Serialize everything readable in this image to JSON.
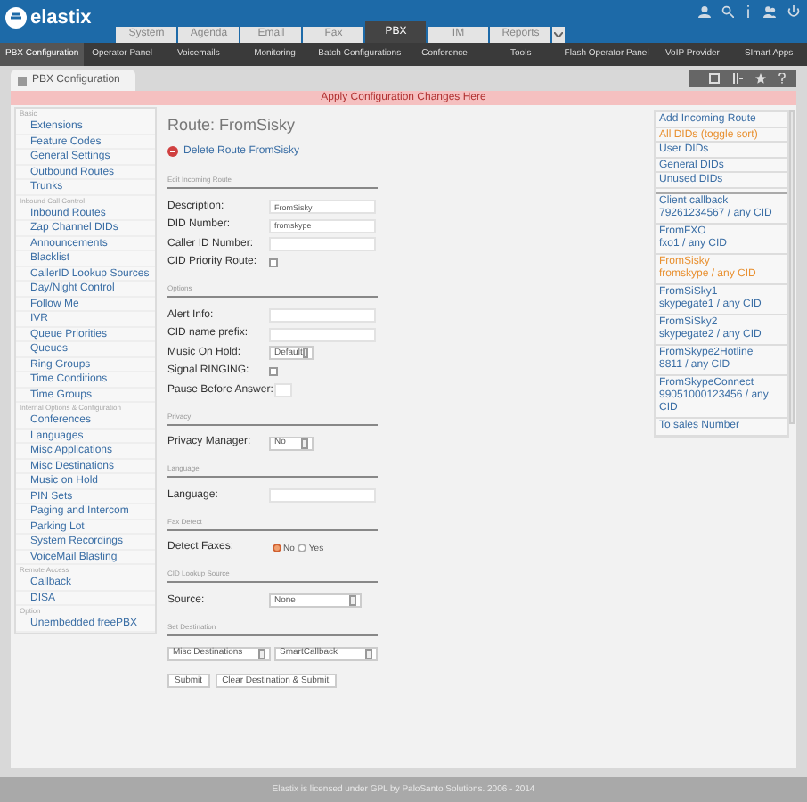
{
  "header": {
    "logo": "elastix",
    "top_tabs": [
      {
        "label": "System",
        "selected": false
      },
      {
        "label": "Agenda",
        "selected": false
      },
      {
        "label": "Email",
        "selected": false
      },
      {
        "label": "Fax",
        "selected": false
      },
      {
        "label": "PBX",
        "selected": true
      },
      {
        "label": "IM",
        "selected": false
      },
      {
        "label": "Reports",
        "selected": false
      }
    ],
    "menu": [
      {
        "label": "PBX Configuration",
        "selected": true
      },
      {
        "label": "Operator Panel",
        "selected": false
      },
      {
        "label": "Voicemails",
        "selected": false
      },
      {
        "label": "Monitoring",
        "selected": false
      },
      {
        "label": "Batch Configurations",
        "selected": false
      },
      {
        "label": "Conference",
        "selected": false
      },
      {
        "label": "Tools",
        "selected": false
      },
      {
        "label": "Flash Operator Panel",
        "selected": false
      },
      {
        "label": "VoIP Provider",
        "selected": false
      },
      {
        "label": "SImart Apps",
        "selected": false
      }
    ]
  },
  "module_tab": "PBX Configuration",
  "apply_banner": "Apply Configuration Changes Here",
  "sidebar": [
    {
      "title": "Basic",
      "items": [
        "Extensions",
        "Feature Codes",
        "General Settings",
        "Outbound Routes",
        "Trunks"
      ]
    },
    {
      "title": "Inbound Call Control",
      "items": [
        "Inbound Routes",
        "Zap Channel DIDs",
        "Announcements",
        "Blacklist",
        "CallerID Lookup Sources",
        "Day/Night Control",
        "Follow Me",
        "IVR",
        "Queue Priorities",
        "Queues",
        "Ring Groups",
        "Time Conditions",
        "Time Groups"
      ]
    },
    {
      "title": "Internal Options & Configuration",
      "items": [
        "Conferences",
        "Languages",
        "Misc Applications",
        "Misc Destinations",
        "Music on Hold",
        "PIN Sets",
        "Paging and Intercom",
        "Parking Lot",
        "System Recordings",
        "VoiceMail Blasting"
      ]
    },
    {
      "title": "Remote Access",
      "items": [
        "Callback",
        "DISA"
      ]
    },
    {
      "title": "Option",
      "items": [
        "Unembedded freePBX"
      ]
    }
  ],
  "main": {
    "title": "Route: FromSisky",
    "delete_link": "Delete Route FromSisky",
    "sections": [
      {
        "title": "Edit Incoming Route",
        "fields": [
          {
            "kind": "text",
            "label": "Description:",
            "value": "FromSisky"
          },
          {
            "kind": "text",
            "label": "DID Number:",
            "value": "fromskype"
          },
          {
            "kind": "text",
            "label": "Caller ID Number:"
          },
          {
            "kind": "checkbox",
            "label": "CID Priority Route:",
            "checked": false
          }
        ]
      },
      {
        "title": "Options",
        "fields": [
          {
            "kind": "text",
            "label": "Alert Info:"
          },
          {
            "kind": "text",
            "label": "CID name prefix:"
          },
          {
            "kind": "select",
            "label": "Music On Hold:",
            "value": "Default"
          },
          {
            "kind": "checkbox",
            "label": "Signal RINGING:",
            "checked": false
          },
          {
            "kind": "text",
            "label": "Pause Before Answer:"
          }
        ]
      },
      {
        "title": "Privacy",
        "fields": [
          {
            "kind": "select",
            "label": "Privacy Manager:",
            "value": "No"
          }
        ]
      },
      {
        "title": "Language",
        "fields": [
          {
            "kind": "text",
            "label": "Language:"
          }
        ]
      },
      {
        "title": "Fax Detect",
        "fields": [
          {
            "kind": "radio",
            "label": "Detect Faxes:",
            "options": [
              {
                "label": "No",
                "selected": true
              },
              {
                "label": "Yes",
                "selected": false
              }
            ]
          }
        ]
      },
      {
        "title": "CID Lookup Source",
        "fields": [
          {
            "kind": "select",
            "label": "Source:",
            "value": "None"
          }
        ]
      },
      {
        "title": "Set Destination",
        "fields": [
          {
            "kind": "selects",
            "values": [
              "Misc Destinations",
              "SmartCallback"
            ]
          }
        ]
      }
    ],
    "buttons": [
      "Submit",
      "Clear Destination & Submit"
    ]
  },
  "right_panel": {
    "actions": [
      {
        "label": "Add Incoming Route",
        "selected": false
      },
      {
        "label": "All DIDs (toggle sort)",
        "selected": true
      },
      {
        "label": "User DIDs",
        "selected": false
      },
      {
        "label": "General DIDs",
        "selected": false
      },
      {
        "label": "Unused DIDs",
        "selected": false
      }
    ],
    "routes": [
      {
        "name": "Client callback",
        "detail": "79261234567 / any CID",
        "selected": false
      },
      {
        "name": "FromFXO",
        "detail": "fxo1 / any CID",
        "selected": false
      },
      {
        "name": "FromSisky",
        "detail": "fromskype / any CID",
        "selected": true
      },
      {
        "name": "FromSiSky1",
        "detail": "skypegate1 / any CID",
        "selected": false
      },
      {
        "name": "FromSiSky2",
        "detail": "skypegate2 / any CID",
        "selected": false
      },
      {
        "name": "FromSkype2Hotline",
        "detail": "8811 / any CID",
        "selected": false
      },
      {
        "name": "FromSkypeConnect",
        "detail": "99051000123456 / any CID",
        "selected": false
      },
      {
        "name": "To sales Number",
        "selected": false
      }
    ]
  },
  "footer": "Elastix is licensed under GPL by PaloSanto Solutions. 2006 - 2014"
}
